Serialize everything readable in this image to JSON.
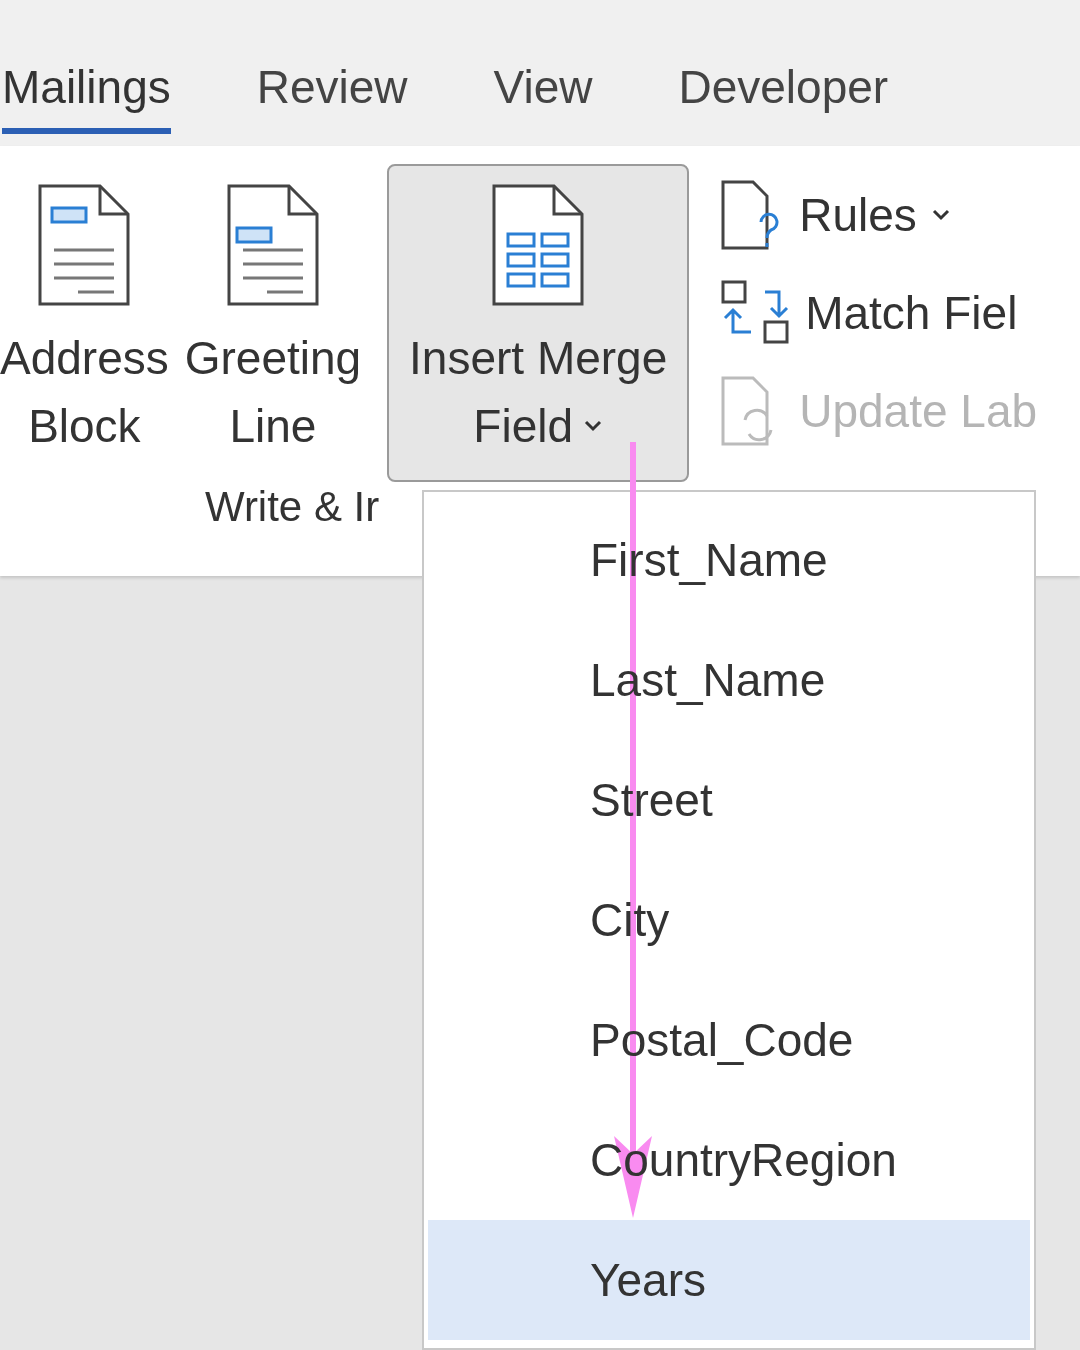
{
  "tabs": [
    {
      "label": "Mailings",
      "selected": true
    },
    {
      "label": "Review",
      "selected": false
    },
    {
      "label": "View",
      "selected": false
    },
    {
      "label": "Developer",
      "selected": false
    }
  ],
  "ribbon": {
    "large_buttons": [
      {
        "kind": "address",
        "line_1": "Address",
        "line_2": "Block",
        "pressed": false,
        "has_menu": false
      },
      {
        "kind": "greeting",
        "line_1": "Greeting",
        "line_2": "Line",
        "pressed": false,
        "has_menu": false
      },
      {
        "kind": "merge",
        "line_1": "Insert Merge",
        "line_2": "Field",
        "pressed": true,
        "has_menu": true
      }
    ],
    "small_buttons": [
      {
        "kind": "rules",
        "label": "Rules",
        "has_menu": true,
        "disabled": false
      },
      {
        "kind": "match",
        "label": "Match Fiel",
        "has_menu": false,
        "disabled": false
      },
      {
        "kind": "update",
        "label": "Update Lab",
        "has_menu": false,
        "disabled": true
      }
    ],
    "group_label": "Write & Ir"
  },
  "menu": {
    "items": [
      {
        "label": "First_Name",
        "selected": false
      },
      {
        "label": "Last_Name",
        "selected": false
      },
      {
        "label": "Street",
        "selected": false
      },
      {
        "label": "City",
        "selected": false
      },
      {
        "label": "Postal_Code",
        "selected": false
      },
      {
        "label": "CountryRegion",
        "selected": false
      },
      {
        "label": "Years",
        "selected": true
      }
    ]
  }
}
